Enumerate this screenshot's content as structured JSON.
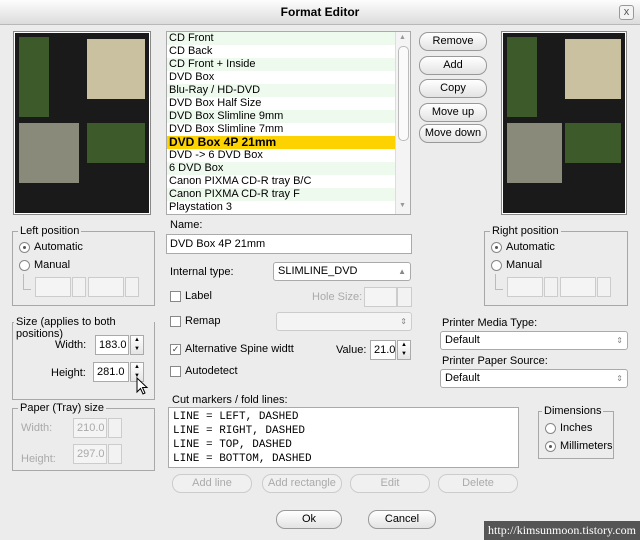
{
  "window": {
    "title": "Format Editor",
    "close": "x"
  },
  "formats": [
    "CD Front",
    "CD Back",
    "CD Front + Inside",
    "DVD Box",
    "Blu-Ray / HD-DVD",
    "DVD Box Half Size",
    "DVD Box Slimline 9mm",
    "DVD Box Slimline 7mm",
    "DVD Box 4P 21mm",
    "DVD -> 6 DVD Box",
    "6 DVD Box",
    "Canon PIXMA CD-R tray B/C",
    "Canon PIXMA CD-R tray F",
    "Playstation 3"
  ],
  "selected_format": "DVD Box 4P 21mm",
  "buttons": {
    "remove": "Remove",
    "add": "Add",
    "copy": "Copy",
    "move_up": "Move up",
    "move_down": "Move down",
    "add_line": "Add line",
    "add_rectangle": "Add rectangle",
    "edit": "Edit",
    "delete": "Delete",
    "ok": "Ok",
    "cancel": "Cancel"
  },
  "left_position": {
    "title": "Left position",
    "automatic": "Automatic",
    "manual": "Manual",
    "selected": "Automatic"
  },
  "right_position": {
    "title": "Right position",
    "automatic": "Automatic",
    "manual": "Manual",
    "selected": "Automatic"
  },
  "size": {
    "title": "Size (applies to both positions)",
    "width_label": "Width:",
    "width": "183.0",
    "height_label": "Height:",
    "height": "281.0"
  },
  "paper": {
    "title": "Paper (Tray) size",
    "width_label": "Width:",
    "width": "210.0",
    "height_label": "Height:",
    "height": "297.0"
  },
  "name": {
    "label": "Name:",
    "value": "DVD Box 4P 21mm"
  },
  "internal_type": {
    "label": "Internal type:",
    "value": "SLIMLINE_DVD"
  },
  "label_checkbox": {
    "label": "Label",
    "checked": false
  },
  "hole_size": {
    "label": "Hole Size:",
    "value": ""
  },
  "remap": {
    "label": "Remap",
    "checked": false,
    "value": ""
  },
  "alt_spine": {
    "label": "Alternative Spine widtt",
    "checked": true
  },
  "value": {
    "label": "Value:",
    "value": "21.0"
  },
  "autodetect": {
    "label": "Autodetect",
    "checked": false
  },
  "cut_markers": {
    "label": "Cut markers / fold lines:",
    "lines": "LINE = LEFT, DASHED\nLINE = RIGHT, DASHED\nLINE = TOP, DASHED\nLINE = BOTTOM, DASHED"
  },
  "printer_media": {
    "label": "Printer Media Type:",
    "value": "Default"
  },
  "printer_source": {
    "label": "Printer Paper Source:",
    "value": "Default"
  },
  "dimensions": {
    "title": "Dimensions",
    "inches": "Inches",
    "millimeters": "Millimeters",
    "selected": "Millimeters"
  },
  "watermark": "http://kimsunmoon.tistory.com",
  "colors": {
    "selection": "#fcd200",
    "row_alt": "#eefaee"
  }
}
